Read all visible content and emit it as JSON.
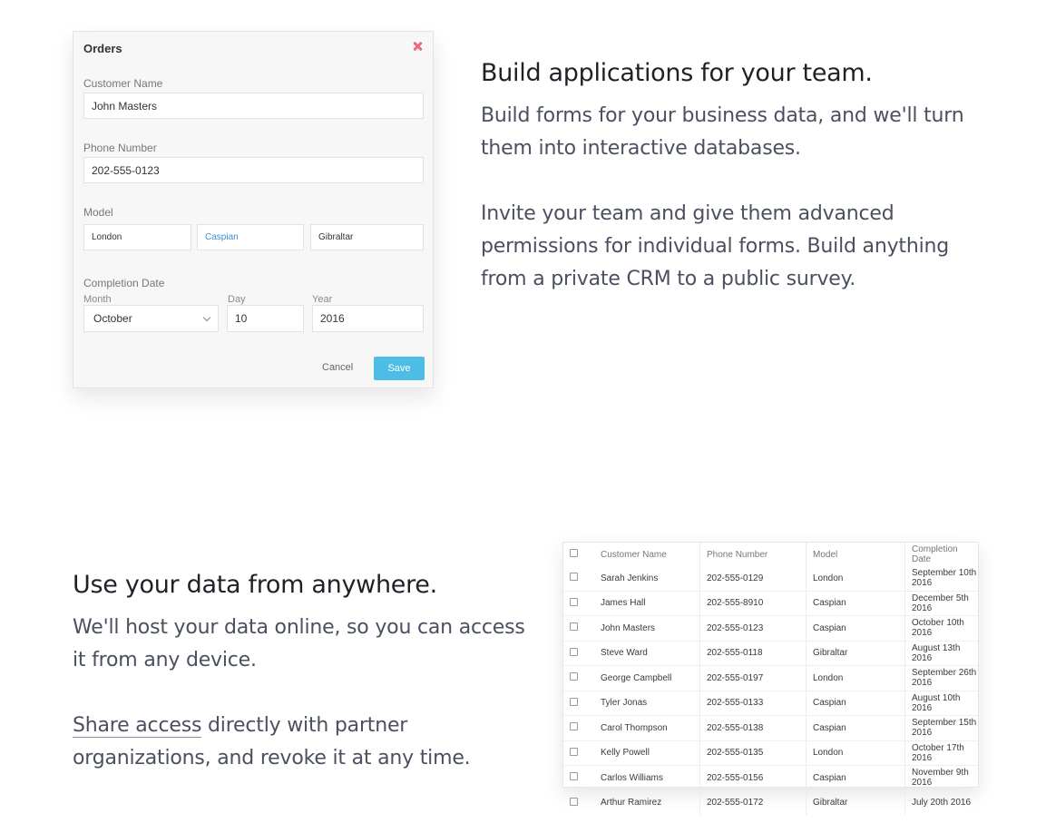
{
  "form": {
    "title": "Orders",
    "customer_name_label": "Customer Name",
    "customer_name_value": "John Masters",
    "phone_label": "Phone Number",
    "phone_value": "202-555-0123",
    "model_label": "Model",
    "model_options": [
      "London",
      "Caspian",
      "Gibraltar"
    ],
    "model_selected": "Caspian",
    "completion_label": "Completion Date",
    "month_label": "Month",
    "month_value": "October",
    "day_label": "Day",
    "day_value": "10",
    "year_label": "Year",
    "year_value": "2016",
    "cancel_label": "Cancel",
    "save_label": "Save",
    "close_icon": "close-x-icon",
    "accent_color": "#4dbde8",
    "close_color": "#e86a83"
  },
  "section1": {
    "headline": "Build applications for your team.",
    "para1_line1": "Build forms for your business data, and we'll turn",
    "para1_line2": "them into interactive databases.",
    "para2_line1": "Invite your team and give them advanced",
    "para2_line2": "permissions for individual forms. Build anything",
    "para2_line3": "from a private CRM to a public survey."
  },
  "section2": {
    "headline": "Use your data from anywhere.",
    "para1_line1": "We'll host your data online, so you can access",
    "para1_line2": "it from any device.",
    "para2_link": "Share access",
    "para2_line1_rest": " directly with partner",
    "para2_line2": "organizations, and revoke it at any time."
  },
  "table": {
    "headers": [
      "Customer Name",
      "Phone Number",
      "Model",
      "Completion Date"
    ],
    "rows": [
      [
        "Sarah Jenkins",
        "202-555-0129",
        "London",
        "September 10th 2016"
      ],
      [
        "James Hall",
        "202-555-8910",
        "Caspian",
        "December 5th 2016"
      ],
      [
        "John Masters",
        "202-555-0123",
        "Caspian",
        "October 10th 2016"
      ],
      [
        "Steve Ward",
        "202-555-0118",
        "Gibraltar",
        "August 13th 2016"
      ],
      [
        "George Campbell",
        "202-555-0197",
        "London",
        "September 26th 2016"
      ],
      [
        "Tyler Jonas",
        "202-555-0133",
        "Caspian",
        "August 10th 2016"
      ],
      [
        "Carol Thompson",
        "202-555-0138",
        "Caspian",
        "September 15th 2016"
      ],
      [
        "Kelly Powell",
        "202-555-0135",
        "London",
        "October 17th 2016"
      ],
      [
        "Carlos Williams",
        "202-555-0156",
        "Caspian",
        "November 9th 2016"
      ],
      [
        "Arthur Ramirez",
        "202-555-0172",
        "Gibraltar",
        "July 20th 2016"
      ]
    ]
  }
}
